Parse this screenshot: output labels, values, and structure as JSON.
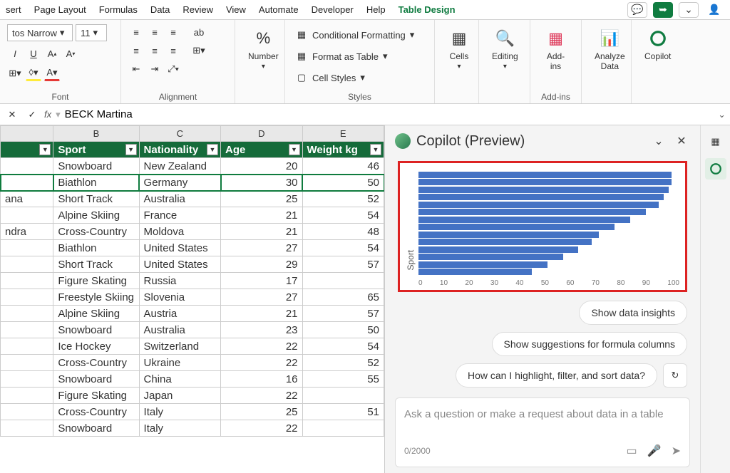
{
  "tabs": {
    "items": [
      "sert",
      "Page Layout",
      "Formulas",
      "Data",
      "Review",
      "View",
      "Automate",
      "Developer",
      "Help",
      "Table Design"
    ],
    "active": "Table Design"
  },
  "ribbon": {
    "font": {
      "family": "tos Narrow",
      "size": "11",
      "label": "Font",
      "bold": "I",
      "underline": "U",
      "strike": "A"
    },
    "alignment": {
      "label": "Alignment",
      "wrap": "ab"
    },
    "number": {
      "label": "Number",
      "pct": "%"
    },
    "styles": {
      "label": "Styles",
      "cond": "Conditional Formatting",
      "table": "Format as Table",
      "cell": "Cell Styles"
    },
    "cells": {
      "label": "Cells"
    },
    "editing": {
      "label": "Editing"
    },
    "addins": {
      "btn": "Add-ins",
      "label": "Add-ins"
    },
    "analyze": {
      "label": "Analyze Data"
    },
    "copilot": {
      "label": "Copilot"
    }
  },
  "formula_bar": {
    "value": "BECK Martina"
  },
  "grid": {
    "cols": [
      "",
      "B",
      "C",
      "D",
      "E"
    ],
    "headers": [
      "",
      "Sport",
      "Nationality",
      "Age",
      "Weight kg"
    ],
    "rows": [
      [
        "",
        "Snowboard",
        "New Zealand",
        "20",
        "46"
      ],
      [
        "",
        "Biathlon",
        "Germany",
        "30",
        "50"
      ],
      [
        "ana",
        "Short Track",
        "Australia",
        "25",
        "52"
      ],
      [
        "",
        "Alpine Skiing",
        "France",
        "21",
        "54"
      ],
      [
        "ndra",
        "Cross-Country",
        "Moldova",
        "21",
        "48"
      ],
      [
        "",
        "Biathlon",
        "United States",
        "27",
        "54"
      ],
      [
        "",
        "Short Track",
        "United States",
        "29",
        "57"
      ],
      [
        "",
        "Figure Skating",
        "Russia",
        "17",
        ""
      ],
      [
        "",
        "Freestyle Skiing",
        "Slovenia",
        "27",
        "65"
      ],
      [
        "",
        "Alpine Skiing",
        "Austria",
        "21",
        "57"
      ],
      [
        "",
        "Snowboard",
        "Australia",
        "23",
        "50"
      ],
      [
        "",
        "Ice Hockey",
        "Switzerland",
        "22",
        "54"
      ],
      [
        "",
        "Cross-Country",
        "Ukraine",
        "22",
        "52"
      ],
      [
        "",
        "Snowboard",
        "China",
        "16",
        "55"
      ],
      [
        "",
        "Figure Skating",
        "Japan",
        "22",
        ""
      ],
      [
        "",
        "Cross-Country",
        "Italy",
        "25",
        "51"
      ],
      [
        "",
        "Snowboard",
        "Italy",
        "22",
        ""
      ]
    ],
    "selected_row": 1
  },
  "copilot": {
    "title": "Copilot (Preview)",
    "suggestions": {
      "insights": "Show data insights",
      "formula": "Show suggestions for formula columns",
      "highlight": "How can I highlight, filter, and sort data?"
    },
    "input": {
      "placeholder": "Ask a question or make a request about data in a table",
      "counter": "0/2000"
    }
  },
  "chart_data": {
    "type": "bar",
    "orientation": "horizontal",
    "ylabel": "Sport",
    "xlabel": "",
    "xlim": [
      0,
      100
    ],
    "xticks": [
      0,
      10,
      20,
      30,
      40,
      50,
      60,
      70,
      80,
      90,
      100
    ],
    "values": [
      98,
      98,
      97,
      95,
      93,
      88,
      82,
      76,
      70,
      67,
      62,
      56,
      50,
      44
    ]
  }
}
